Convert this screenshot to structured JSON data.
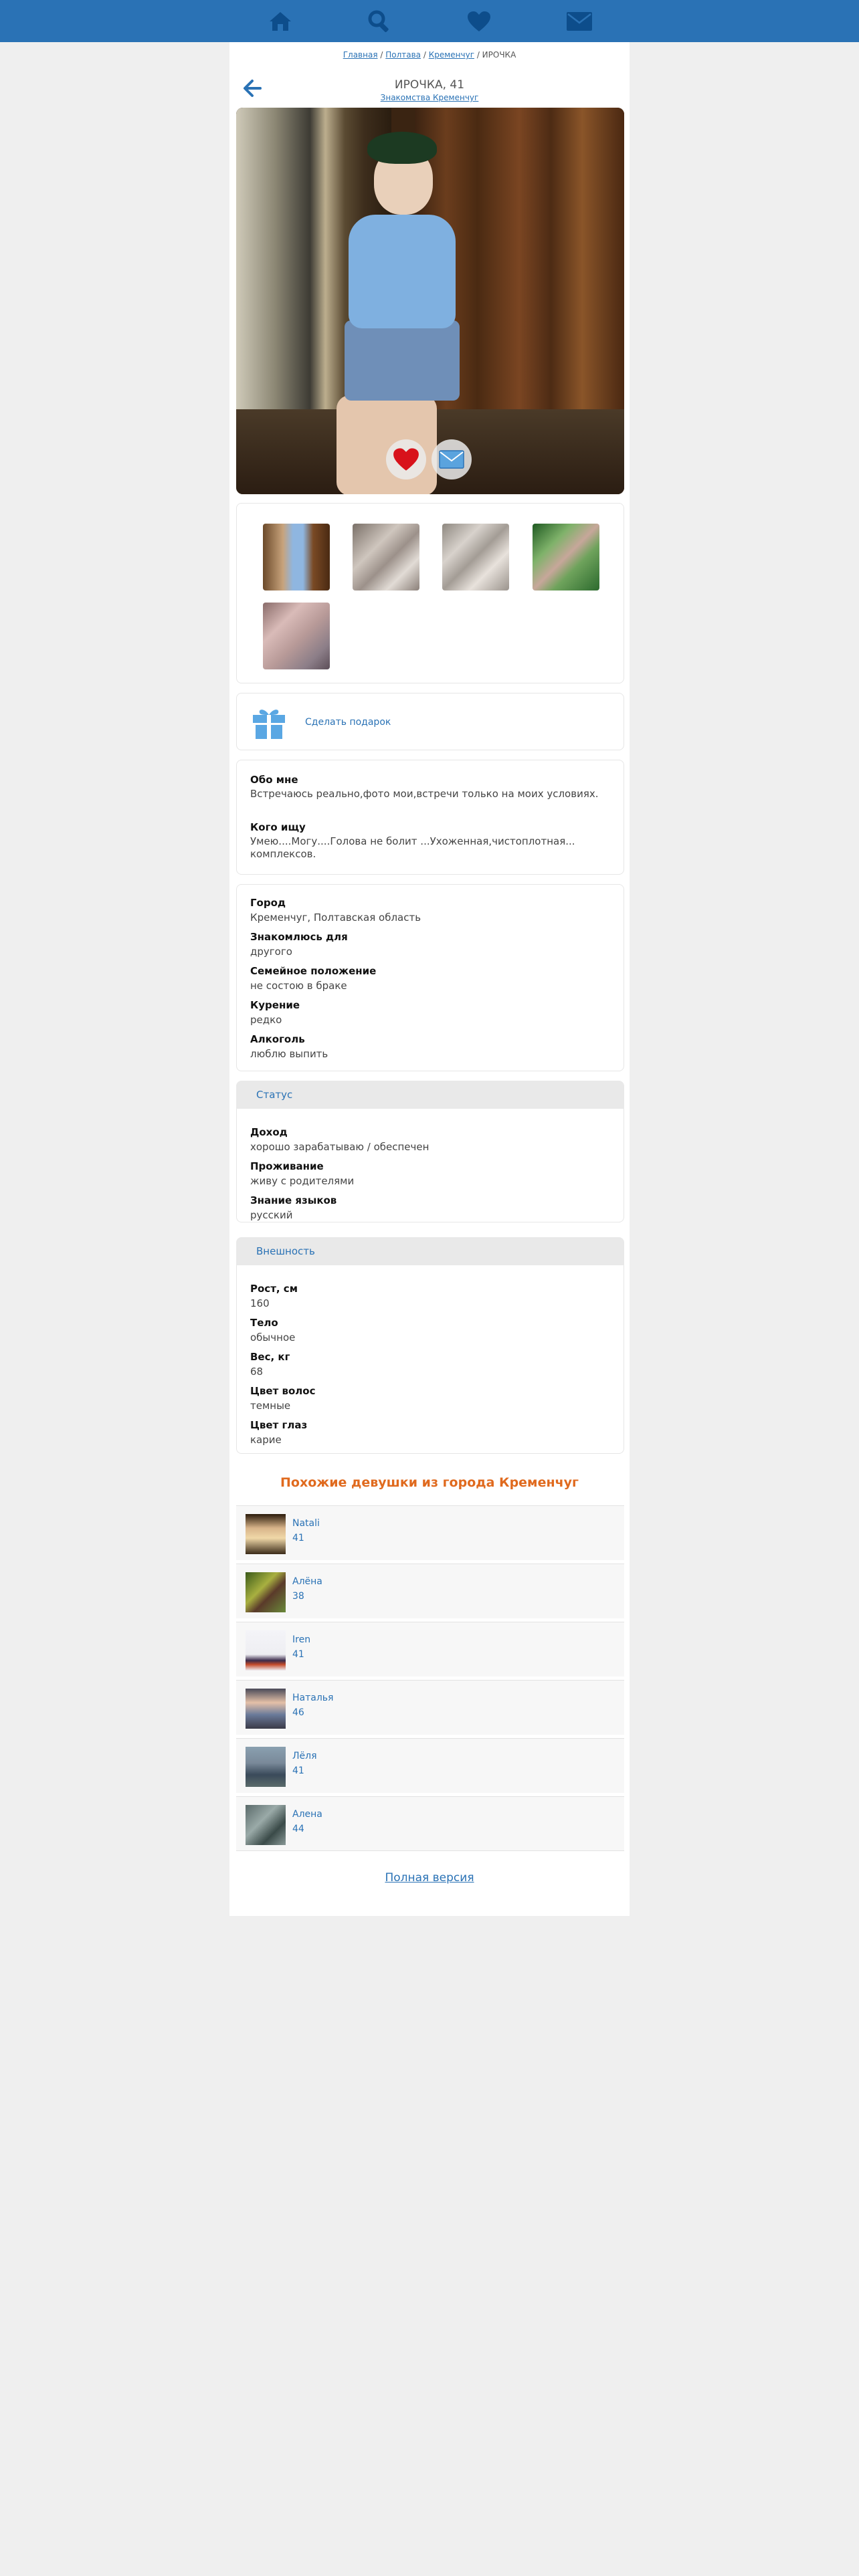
{
  "nav": [
    {
      "name": "home-icon"
    },
    {
      "name": "search-icon"
    },
    {
      "name": "heart-icon"
    },
    {
      "name": "mail-icon"
    }
  ],
  "breadcrumb": {
    "items": [
      "Главная",
      "Полтава",
      "Кременчуг"
    ],
    "separator": " / ",
    "current": "ИРОЧКА"
  },
  "profile": {
    "title": "ИРОЧКА, 41",
    "subtitle": "Знакомства Кременчуг"
  },
  "gift": {
    "label": "Сделать подарок"
  },
  "about": {
    "about_title": "Обо мне",
    "about_text": "Встречаюсь реально,фото мои,встречи только на моих условиях.",
    "seek_title": "Кого ищу",
    "seek_text": "Умею....Могу....Голова не болит ...Ухоженная,чистоплотная... комплексов."
  },
  "details": [
    {
      "label": "Город",
      "value": "Кременчуг, Полтавская область"
    },
    {
      "label": "Знакомлюсь для",
      "value": "другого"
    },
    {
      "label": "Семейное положение",
      "value": "не состою в браке"
    },
    {
      "label": "Курение",
      "value": "редко"
    },
    {
      "label": "Алкоголь",
      "value": "люблю выпить"
    }
  ],
  "status": {
    "heading": "Статус",
    "items": [
      {
        "label": "Доход",
        "value": "хорошо зарабатываю / обеспечен"
      },
      {
        "label": "Проживание",
        "value": "живу с родителями"
      },
      {
        "label": "Знание языков",
        "value": "русский"
      }
    ]
  },
  "appearance": {
    "heading": "Внешность",
    "items": [
      {
        "label": "Рост, см",
        "value": "160"
      },
      {
        "label": "Тело",
        "value": "обычное"
      },
      {
        "label": "Вес, кг",
        "value": "68"
      },
      {
        "label": "Цвет волос",
        "value": "темные"
      },
      {
        "label": "Цвет глаз",
        "value": "карие"
      }
    ]
  },
  "similar": {
    "title": "Похожие девушки из города Кременчуг",
    "items": [
      {
        "name": "Natali",
        "age": "41"
      },
      {
        "name": "Алёна",
        "age": "38"
      },
      {
        "name": "Iren",
        "age": "41"
      },
      {
        "name": "Наталья",
        "age": "46"
      },
      {
        "name": "Лёля",
        "age": "41"
      },
      {
        "name": "Алена",
        "age": "44"
      }
    ]
  },
  "footer": {
    "full_version": "Полная версия"
  },
  "colors": {
    "accent": "#2a72b5",
    "header": "#2a72b5",
    "highlight": "#e06a1e"
  }
}
